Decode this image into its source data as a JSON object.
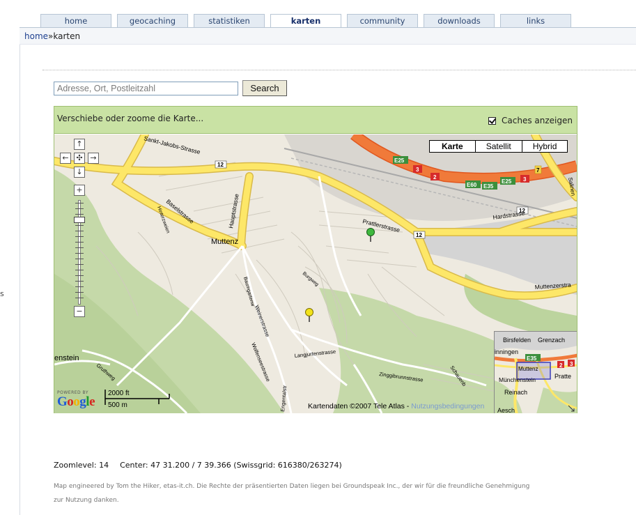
{
  "nav": {
    "tabs": [
      {
        "label": "home",
        "active": false
      },
      {
        "label": "geocaching",
        "active": false
      },
      {
        "label": "statistiken",
        "active": false
      },
      {
        "label": "karten",
        "active": true
      },
      {
        "label": "community",
        "active": false
      },
      {
        "label": "downloads",
        "active": false
      },
      {
        "label": "links",
        "active": false
      }
    ]
  },
  "breadcrumb": {
    "home": "home",
    "separator": "»",
    "current": "karten"
  },
  "search": {
    "placeholder": "Adresse, Ort, Postleitzahl",
    "value": "",
    "button_label": "Search"
  },
  "map": {
    "hint": "Verschiebe oder zoome die Karte...",
    "caches_toggle": {
      "label": "Caches anzeigen",
      "checked": true
    },
    "map_types": [
      {
        "label": "Karte",
        "active": true
      },
      {
        "label": "Satellit",
        "active": false
      },
      {
        "label": "Hybrid",
        "active": false
      }
    ],
    "controls": {
      "pan_up": "↑",
      "pan_left": "←",
      "pan_center": "✣",
      "pan_right": "→",
      "pan_down": "↓",
      "zoom_in": "+",
      "zoom_out": "−"
    },
    "street_labels": {
      "sankt_jakobs": "Sankt-Jakobs-Strasse",
      "hauptstrasse": "Hauptstrasse",
      "baselstrasse": "Baselstrasse",
      "muttenz": "Muttenz",
      "prattlerstrasse": "Prattlerstrasse",
      "hardstrasse": "Hardstrasse",
      "muttenzerstrasse": "Muttenzerstra",
      "salinen": "Salinen",
      "enstein": "enstein",
      "weinerstrasse": "Weinerstrasse",
      "wolfensteenstrasse": "Wolfenseestrasse",
      "langjurtenstrasse": "Langjurtenstrasse",
      "zinggibrunnstrasse": "Zinggibrunnstrasse",
      "engentalstrasse": "Engentalstr",
      "schauenburger": "Schauenb",
      "gruthweg": "Gruthweg",
      "hinterzweien": "Hinterzweien",
      "burgweg": "Burgweg",
      "baumgarten": "Baumgartenw"
    },
    "road_shields": {
      "r12": "12",
      "e25": "E25",
      "e35": "E35",
      "e60": "E60",
      "a3": "3",
      "a2": "2",
      "a7": "7"
    },
    "powered_by": "POWERED BY",
    "logo": {
      "g1": "G",
      "o1": "o",
      "o2": "o",
      "g2": "g",
      "l": "l",
      "e": "e"
    },
    "scale": {
      "imperial": "2000 ft",
      "metric": "500 m"
    },
    "copyright": "Kartendaten ©2007 Tele Atlas - ",
    "terms_link": "Nutzungsbedingungen",
    "overview_labels": {
      "birsfelden": "Birsfelden",
      "grenzach": "Grenzach",
      "inningen": "inningen",
      "e35": "E35",
      "muttenz": "Muttenz",
      "pratte": "Pratte",
      "muenchenstein": "Münchenstein",
      "reinach": "Reinach",
      "aesch": "Aesch",
      "s2": "2",
      "s3": "3"
    },
    "colors": {
      "highway": "#f07a3a",
      "main_road": "#fde768",
      "water_railway": "#d4d4d4",
      "forest": "#c5d9a9",
      "land": "#eeeae0",
      "header": "#c9e2a4"
    }
  },
  "status": {
    "zoom": "Zoomlevel: 14",
    "center": "Center: 47 31.200 / 7 39.366 (Swissgrid: 616380/263274)"
  },
  "credits": "Map engineered by Tom the Hiker, etas-it.ch. Die Rechte der präsentierten Daten liegen bei Groundspeak Inc., der wir für die freundliche Genehmigung zur Nutzung danken.",
  "left_marker": "s"
}
